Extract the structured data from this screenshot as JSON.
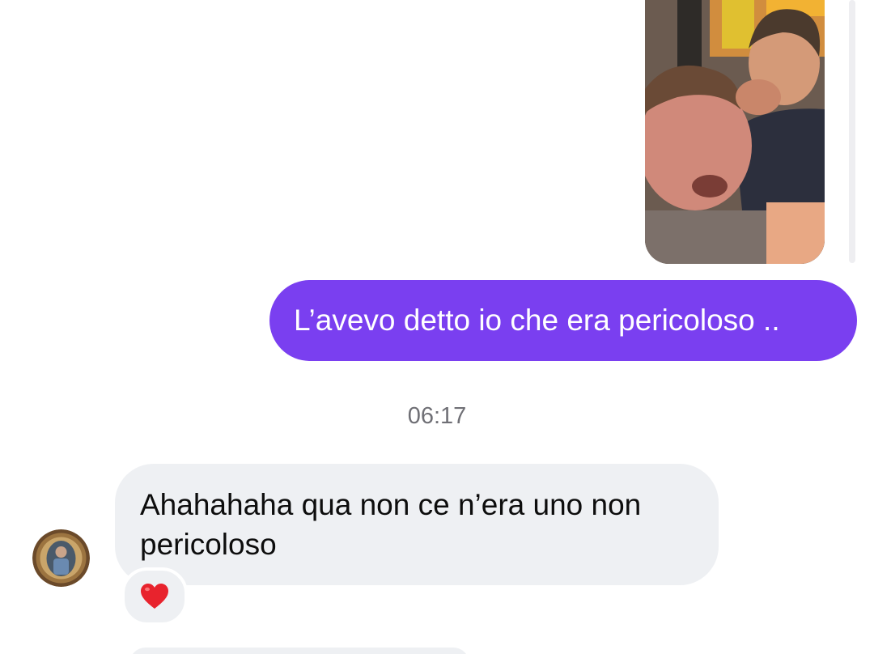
{
  "conversation": {
    "messages": [
      {
        "direction": "outgoing",
        "type": "photo"
      },
      {
        "direction": "outgoing",
        "type": "text",
        "text": "L’avevo detto io che era pericoloso .."
      },
      {
        "type": "timestamp",
        "text": "06:17"
      },
      {
        "direction": "incoming",
        "type": "text",
        "lines": [
          "Ahahahaha qua non ce n’era uno non",
          "pericoloso"
        ],
        "reaction": "heart-emoji"
      }
    ]
  },
  "colors": {
    "outgoing_bubble": "#7a3ff0",
    "incoming_bubble": "#eef0f3",
    "timestamp_text": "#6f6f75",
    "reaction_heart": "#e8232d"
  }
}
